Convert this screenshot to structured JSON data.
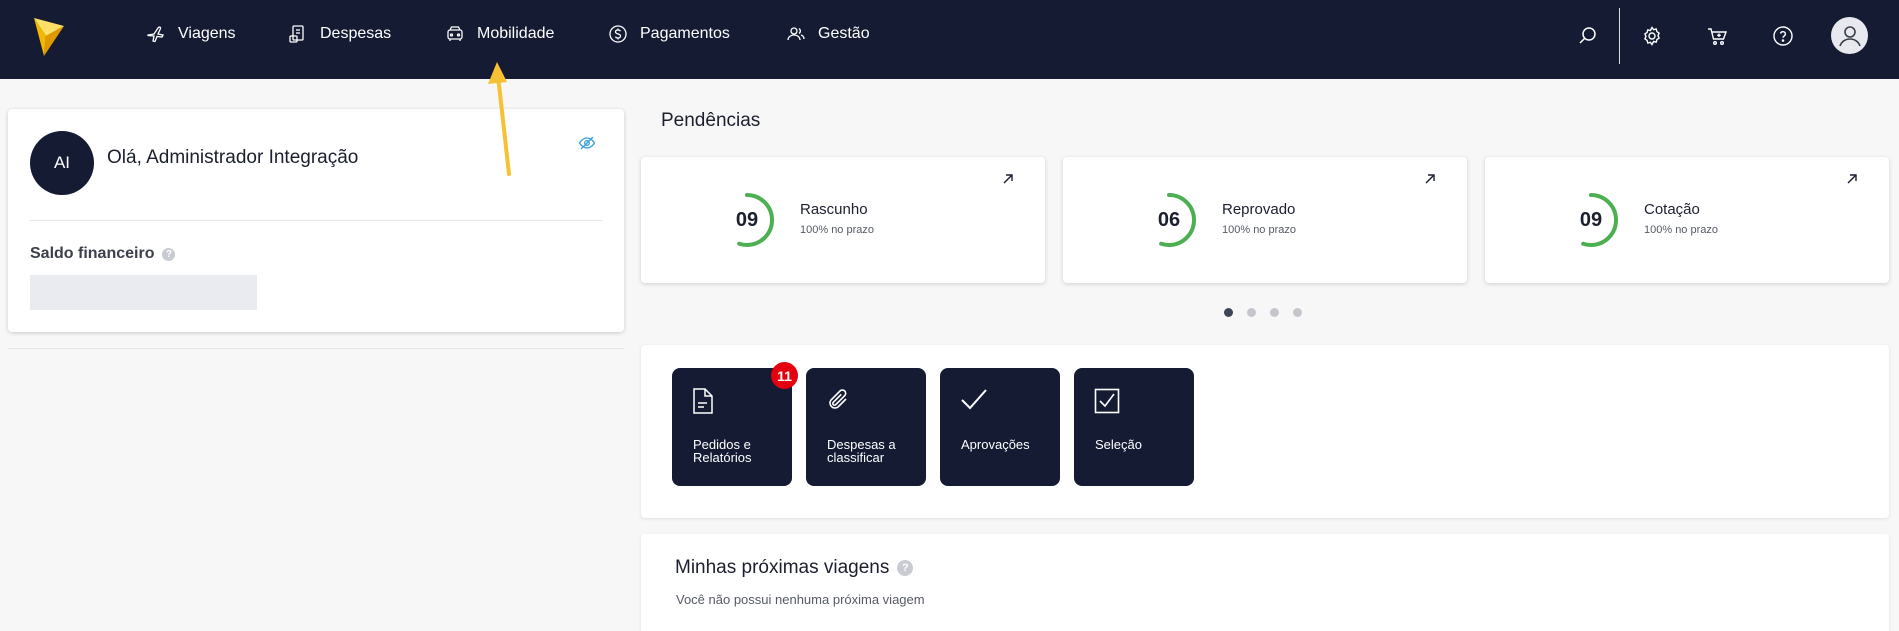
{
  "nav": {
    "items": [
      {
        "label": "Viagens",
        "icon": "plane-icon"
      },
      {
        "label": "Despesas",
        "icon": "receipt-icon"
      },
      {
        "label": "Mobilidade",
        "icon": "car-icon"
      },
      {
        "label": "Pagamentos",
        "icon": "dollar-circle-icon"
      },
      {
        "label": "Gestão",
        "icon": "users-icon"
      }
    ],
    "right_icons": [
      "search-icon",
      "gear-icon",
      "cart-icon",
      "help-icon",
      "user-avatar-icon"
    ]
  },
  "welcome": {
    "initials": "AI",
    "greeting": "Olá, Administrador Integração",
    "balance_label": "Saldo financeiro",
    "help_glyph": "?"
  },
  "pendencias": {
    "title": "Pendências",
    "cards": [
      {
        "count": "09",
        "title": "Rascunho",
        "subtitle": "100% no prazo",
        "ring_fraction": 0.55
      },
      {
        "count": "06",
        "title": "Reprovado",
        "subtitle": "100% no prazo",
        "ring_fraction": 0.55
      },
      {
        "count": "09",
        "title": "Cotação",
        "subtitle": "100% no prazo",
        "ring_fraction": 0.55
      }
    ],
    "pagination": {
      "pages": 4,
      "active": 1
    }
  },
  "quick_actions": [
    {
      "label": "Pedidos e Relatórios",
      "icon": "document-icon",
      "badge": "11"
    },
    {
      "label": "Despesas a classificar",
      "icon": "paperclip-icon",
      "badge": ""
    },
    {
      "label": "Aprovações",
      "icon": "checkmark-icon",
      "badge": ""
    },
    {
      "label": "Seleção",
      "icon": "checkbox-icon",
      "badge": ""
    }
  ],
  "trips": {
    "title": "Minhas próximas viagens",
    "help_glyph": "?",
    "empty_text": "Você não possui nenhuma próxima viagem"
  },
  "colors": {
    "nav_bg": "#141b33",
    "ring_green": "#4caf50",
    "badge_red": "#e3000f",
    "logo_yellow": "#f5b800",
    "annotation_yellow": "#f7c134"
  }
}
